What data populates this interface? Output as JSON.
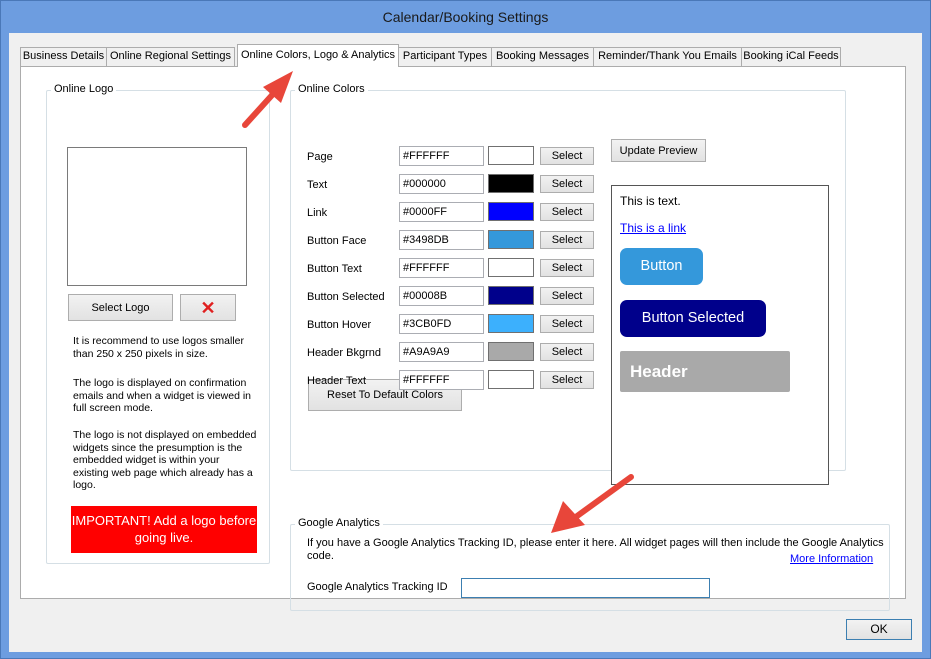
{
  "window": {
    "title": "Calendar/Booking Settings"
  },
  "tabs": [
    {
      "label": "Business Details"
    },
    {
      "label": "Online Regional Settings"
    },
    {
      "label": "Online Colors, Logo & Analytics"
    },
    {
      "label": "Participant Types"
    },
    {
      "label": "Booking Messages"
    },
    {
      "label": "Reminder/Thank You Emails"
    },
    {
      "label": "Booking iCal Feeds"
    }
  ],
  "logo": {
    "group_label": "Online Logo",
    "select_label": "Select Logo",
    "delete_glyph": "✕",
    "note1": "It is recommend to use logos smaller than 250 x 250 pixels in size.",
    "note2": "The logo is displayed on confirmation emails and when a widget is viewed in full screen mode.",
    "note3": "The logo is not displayed on embedded widgets since the presumption is the embedded widget is within your existing web page which already has a logo.",
    "important": "IMPORTANT!  Add a logo before going live."
  },
  "colors": {
    "group_label": "Online Colors",
    "select_label": "Select",
    "reset_label": "Reset To Default Colors",
    "update_label": "Update Preview",
    "items": [
      {
        "label": "Page",
        "hex": "#FFFFFF",
        "swatch": "#FFFFFF"
      },
      {
        "label": "Text",
        "hex": "#000000",
        "swatch": "#000000"
      },
      {
        "label": "Link",
        "hex": "#0000FF",
        "swatch": "#0000FF"
      },
      {
        "label": "Button Face",
        "hex": "#3498DB",
        "swatch": "#3498DB"
      },
      {
        "label": "Button Text",
        "hex": "#FFFFFF",
        "swatch": "#FFFFFF"
      },
      {
        "label": "Button Selected",
        "hex": "#00008B",
        "swatch": "#00008B"
      },
      {
        "label": "Button Hover",
        "hex": "#3CB0FD",
        "swatch": "#3CB0FD"
      },
      {
        "label": "Header Bkgrnd",
        "hex": "#A9A9A9",
        "swatch": "#A9A9A9"
      },
      {
        "label": "Header Text",
        "hex": "#FFFFFF",
        "swatch": "#FFFFFF"
      }
    ]
  },
  "preview": {
    "text": "This is text.",
    "link": "This is a link",
    "button": "Button",
    "button_selected": "Button Selected",
    "header": "Header"
  },
  "analytics": {
    "group_label": "Google Analytics",
    "description": "If you have a Google Analytics Tracking ID, please enter it here.  All widget pages will then include the Google Analytics code.",
    "more_info": "More Information",
    "field_label": "Google Analytics Tracking ID",
    "field_value": ""
  },
  "footer": {
    "ok_label": "OK"
  },
  "annotations": {
    "arrow_color": "#E8463A"
  }
}
